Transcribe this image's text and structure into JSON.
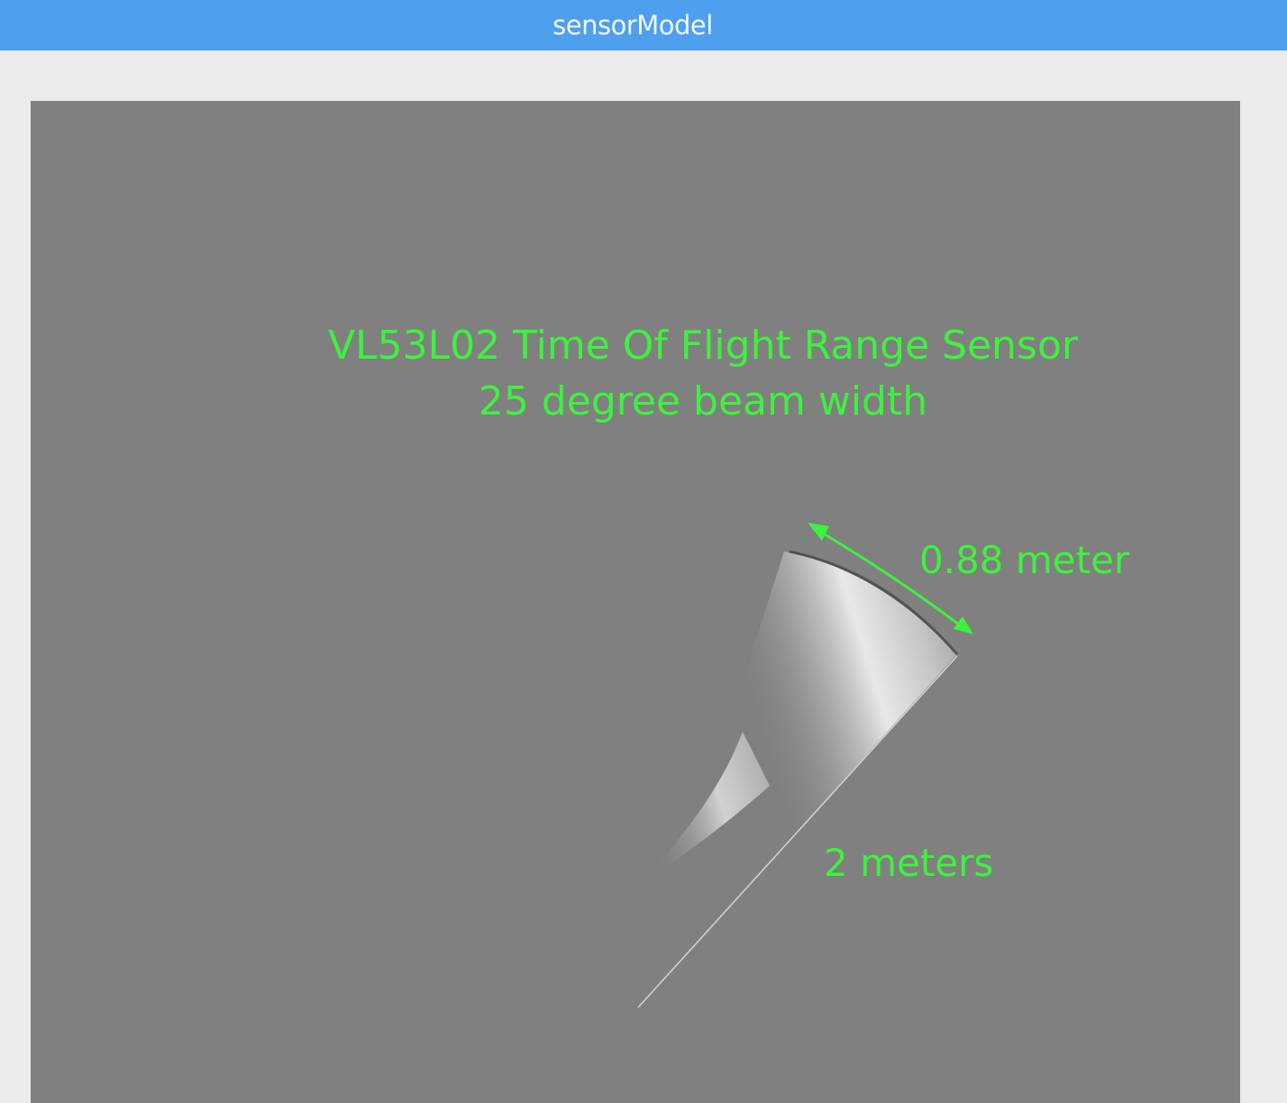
{
  "window": {
    "title": "sensorModel"
  },
  "scene": {
    "title_line1": "VL53L02 Time Of Flight Range Sensor",
    "title_line2": "25 degree beam width",
    "arc_label": "0.88 meter",
    "range_label": "2 meters",
    "colors": {
      "background": "#808080",
      "annotation": "#3df23d",
      "titlebar": "#4e9fee"
    }
  }
}
